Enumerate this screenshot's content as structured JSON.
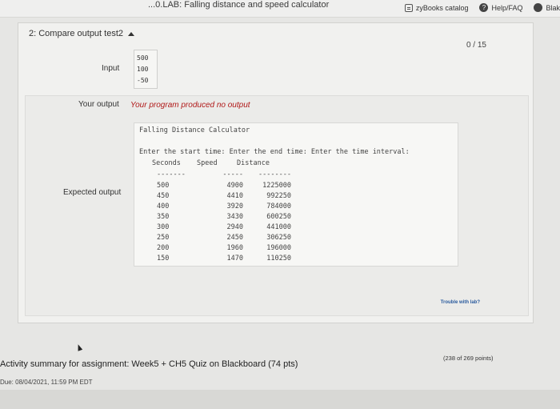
{
  "header": {
    "page_title": "...0.LAB: Falling distance and speed calculator",
    "links": [
      {
        "label": "zyBooks catalog",
        "icon": "book-icon"
      },
      {
        "label": "Help/FAQ",
        "icon": "help-icon"
      },
      {
        "label": "Blak",
        "icon": "user-icon"
      }
    ]
  },
  "test": {
    "title": "2: Compare output test2",
    "score": "0 / 15",
    "input_label": "Input",
    "input_values": [
      "500",
      "100",
      "-50"
    ],
    "your_output_label": "Your output",
    "your_output_text": "Your program produced no output",
    "expected_label": "Expected output",
    "expected": {
      "title": "Falling Distance Calculator",
      "prompt": "Enter the start time: Enter the end time: Enter the time interval:",
      "headers": [
        "Seconds",
        "Speed",
        "Distance"
      ],
      "dashes": [
        "-------",
        "-----",
        "--------"
      ],
      "rows": [
        [
          "500",
          "4900",
          "1225000"
        ],
        [
          "450",
          "4410",
          "992250"
        ],
        [
          "400",
          "3920",
          "784000"
        ],
        [
          "350",
          "3430",
          "600250"
        ],
        [
          "300",
          "2940",
          "441000"
        ],
        [
          "250",
          "2450",
          "306250"
        ],
        [
          "200",
          "1960",
          "196000"
        ],
        [
          "150",
          "1470",
          "110250"
        ]
      ]
    },
    "trouble_link": "Trouble with lab?"
  },
  "summary": {
    "activity": "Activity summary for assignment: Week5 + CH5 Quiz on Blackboard (74 pts)",
    "due": "Due: 08/04/2021, 11:59 PM EDT",
    "points": "(238 of 269 points)"
  }
}
